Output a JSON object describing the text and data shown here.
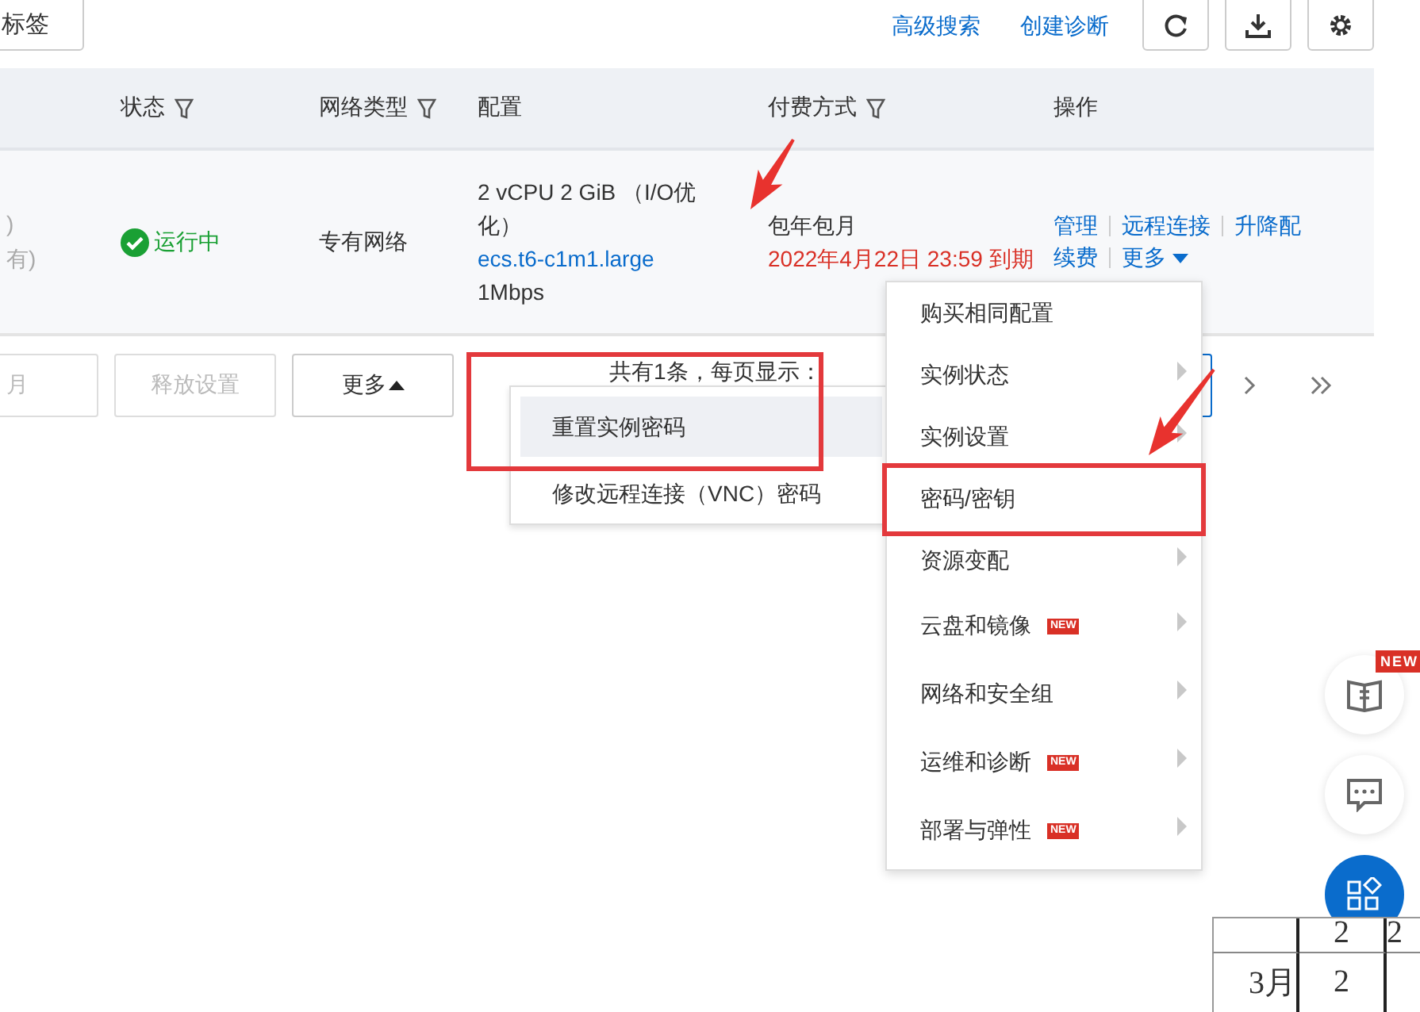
{
  "toolbar": {
    "tag_button": "标签",
    "links": [
      "高级搜索",
      "创建诊断"
    ],
    "icon_buttons": [
      {
        "kind": "refresh"
      },
      {
        "kind": "download"
      },
      {
        "kind": "settings"
      }
    ]
  },
  "table": {
    "columns": [
      {
        "label": "状态",
        "filter": true
      },
      {
        "label": "网络类型",
        "filter": true
      },
      {
        "label": "配置",
        "filter": false
      },
      {
        "label": "付费方式",
        "filter": true
      },
      {
        "label": "操作",
        "filter": false
      }
    ],
    "row": {
      "column_1": [
        ")",
        "有)"
      ],
      "status": "运行中",
      "network": "专有网络",
      "config": [
        "2 vCPU 2 GiB （I/O优化）",
        "ecs.t6-c1m1.large",
        "1Mbps"
      ],
      "billing": "包年包月",
      "expiry": "2022年4月22日 23:59 到期",
      "actions": [
        "管理",
        "远程连接",
        "升降配",
        "续费"
      ],
      "more": "更多"
    }
  },
  "footer": {
    "buttons": [
      {
        "label": "月",
        "disabled": true
      },
      {
        "label": "释放设置",
        "disabled": true
      },
      {
        "label": "更多",
        "disabled": false
      }
    ],
    "summary": "共有1条，每页显示："
  },
  "more_menu": [
    {
      "label": "购买相同配置",
      "submenu": false
    },
    {
      "label": "实例状态",
      "submenu": true
    },
    {
      "label": "实例设置",
      "submenu": true
    },
    {
      "label": "密码/密钥",
      "submenu": false
    },
    {
      "label": "资源变配",
      "submenu": true
    },
    {
      "label": "云盘和镜像",
      "submenu": true,
      "badge": "NEW"
    },
    {
      "label": "网络和安全组",
      "submenu": true
    },
    {
      "label": "运维和诊断",
      "submenu": true,
      "badge": "NEW"
    },
    {
      "label": "部署与弹性",
      "submenu": true,
      "badge": "NEW"
    }
  ],
  "submenu": [
    {
      "label": "重置实例密码",
      "selected": true
    },
    {
      "label": "修改远程连接（VNC）密码",
      "selected": false
    }
  ],
  "float_badge": "NEW",
  "sheet": [
    {
      "column_2": "2",
      "column_3": "2"
    },
    {
      "column_1": "3月",
      "column_2": "2"
    }
  ]
}
